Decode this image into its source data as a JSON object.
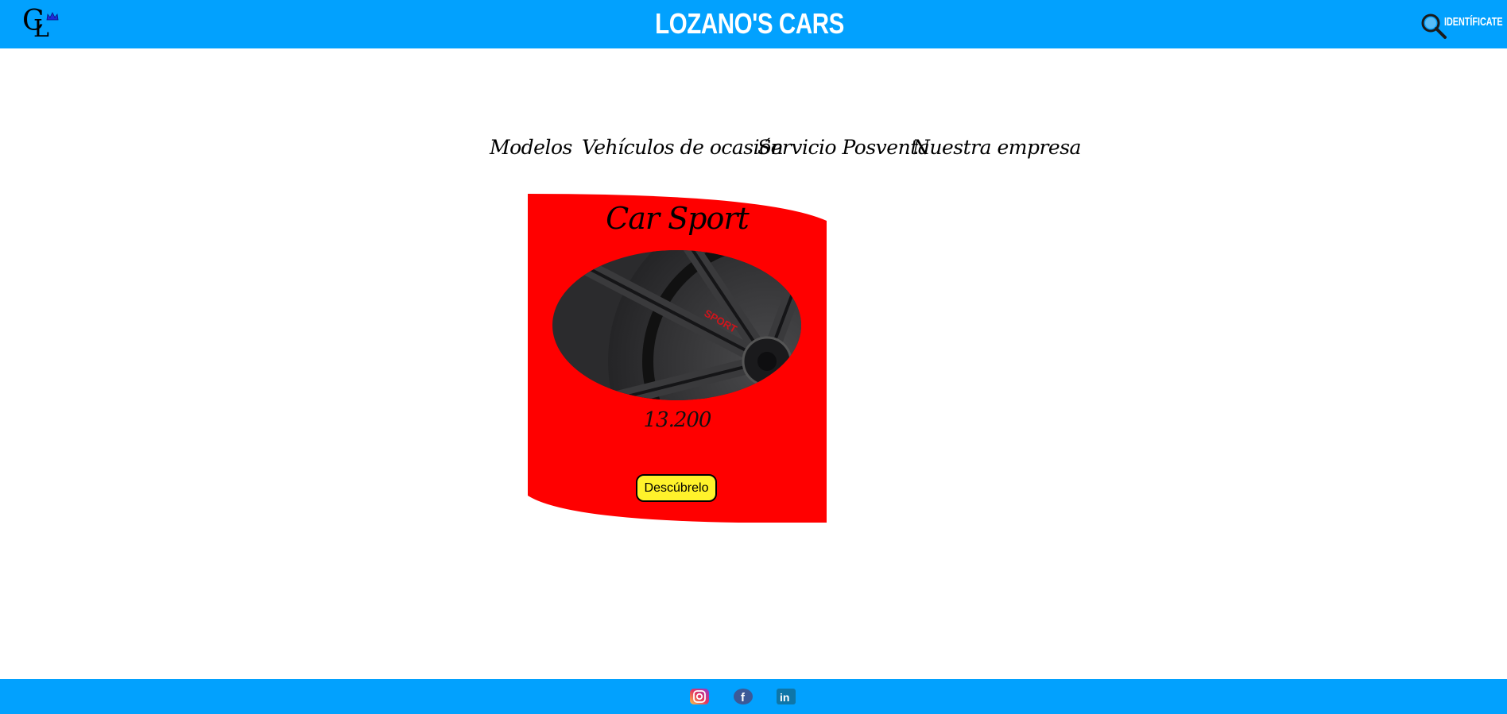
{
  "header": {
    "logo_letters": "CL",
    "brand": "LOZANO'S CARS",
    "login_label": "IDENTÍFICATE",
    "background": "#02a1fe"
  },
  "nav": {
    "items": [
      {
        "label": "Modelos"
      },
      {
        "label": "Vehículos de ocasión"
      },
      {
        "label": "Servicio Posventa"
      },
      {
        "label": "Nuestra empresa"
      }
    ]
  },
  "card": {
    "title": "Car Sport",
    "image_alt": "sport wheel",
    "image_text": "SPORT",
    "price": "13.200",
    "button_label": "Descúbrelo",
    "background": "#ff0000",
    "button_color": "#fff22b"
  },
  "footer": {
    "social": [
      {
        "icon": "instagram-icon"
      },
      {
        "icon": "facebook-icon"
      },
      {
        "icon": "linkedin-icon"
      }
    ]
  }
}
